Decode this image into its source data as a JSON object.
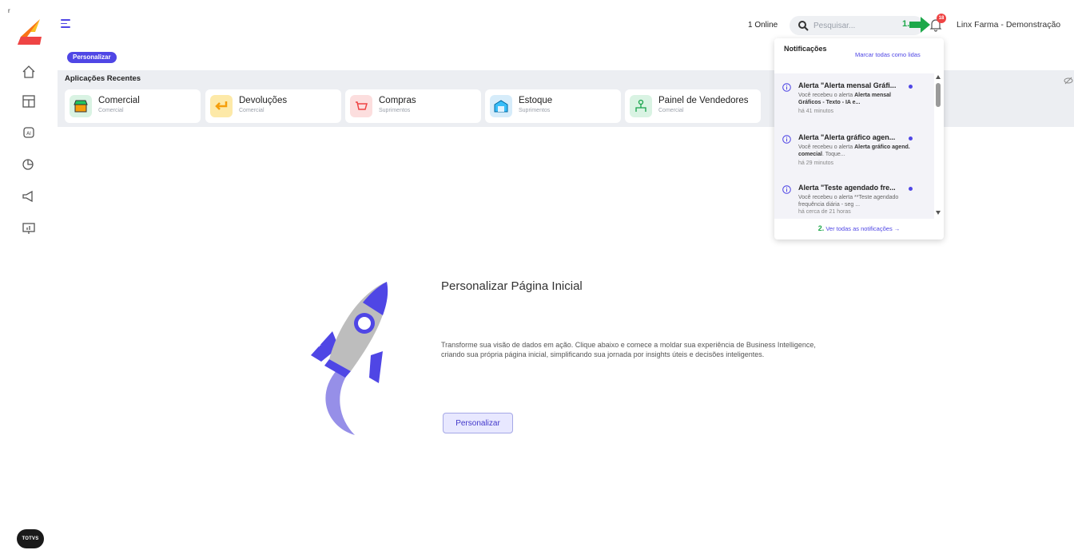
{
  "sidebar": {
    "tiny_mark": "r",
    "bottom_logo_text": "TOTVS",
    "items": [
      {
        "name": "home-icon"
      },
      {
        "name": "dashboard-icon"
      },
      {
        "name": "ai-icon"
      },
      {
        "name": "analytics-icon"
      },
      {
        "name": "campaign-icon"
      },
      {
        "name": "presentation-icon"
      }
    ]
  },
  "header": {
    "online_label": "1 Online",
    "search_placeholder": "Pesquisar...",
    "annotation_1": "1.",
    "notification_count": "18",
    "account_name": "Linx Farma - Demonstração"
  },
  "content": {
    "personalize_chip": "Personalizar",
    "recent_title": "Aplicações Recentes",
    "recent_apps": [
      {
        "name": "Comercial",
        "subtitle": "Comercial",
        "icon": "shop-icon",
        "color": "#d9f3e3"
      },
      {
        "name": "Devoluções",
        "subtitle": "Comercial",
        "icon": "return-icon",
        "color": "#fde9a8"
      },
      {
        "name": "Compras",
        "subtitle": "Suprimentos",
        "icon": "cart-icon",
        "color": "#fcdede"
      },
      {
        "name": "Estoque",
        "subtitle": "Suprimentos",
        "icon": "warehouse-icon",
        "color": "#d6ecfa"
      },
      {
        "name": "Painel de Vendedores",
        "subtitle": "Comercial",
        "icon": "team-icon",
        "color": "#d9f3e3"
      }
    ]
  },
  "hero": {
    "title": "Personalizar Página Inicial",
    "text": "Transforme sua visão de dados em ação. Clique abaixo e comece a moldar sua experiência de Business Intelligence, criando sua própria página inicial, simplificando sua jornada por insights úteis e decisões inteligentes.",
    "button": "Personalizar"
  },
  "notifications": {
    "title": "Notificações",
    "mark_all": "Marcar todas como lidas",
    "items": [
      {
        "title": "Alerta \"Alerta mensal Gráfi...",
        "desc_pre": "Você recebeu o alerta ",
        "desc_bold": "Alerta mensal Gráficos - Texto - IA e...",
        "desc_post": "",
        "time": "há 41 minutos"
      },
      {
        "title": "Alerta \"Alerta gráfico agen...",
        "desc_pre": "Você recebeu o alerta ",
        "desc_bold": "Alerta gráfico agend. comecial",
        "desc_post": ". Toque...",
        "time": "há 29 minutos"
      },
      {
        "title": "Alerta \"Teste agendado fre...",
        "desc_pre": "Você recebeu o alerta **Teste agendado frequência diária - seg ...",
        "desc_bold": "",
        "desc_post": "",
        "time": "há cerca de 21 horas"
      }
    ],
    "annotation_2": "2.",
    "see_all": "Ver todas as notificações →"
  },
  "colors": {
    "accent": "#4f46e5",
    "annotation_green": "#1ea84a",
    "badge_red": "#ef4444",
    "strip_bg": "#eceef2"
  }
}
